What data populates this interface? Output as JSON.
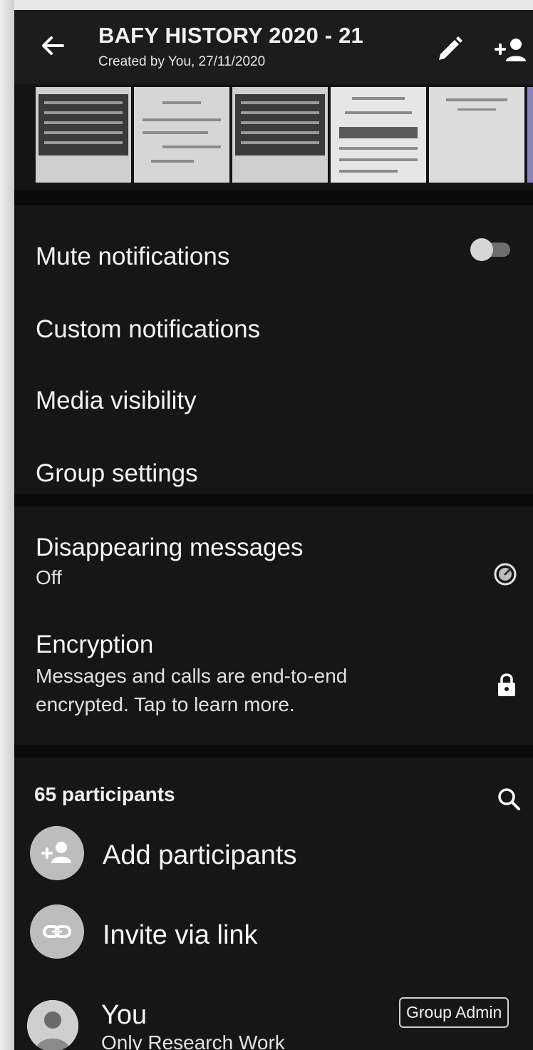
{
  "header": {
    "title": "BAFY HISTORY 2020 - 21",
    "subtitle": "Created by You, 27/11/2020",
    "icons": [
      "back-arrow-icon",
      "pencil-icon",
      "add-person-icon"
    ]
  },
  "settings": {
    "mute_notifications": {
      "label": "Mute notifications",
      "toggle_on": false
    },
    "custom_notifications": {
      "label": "Custom notifications"
    },
    "media_visibility": {
      "label": "Media visibility"
    },
    "group_settings": {
      "label": "Group settings"
    }
  },
  "disappearing": {
    "label": "Disappearing messages",
    "value": "Off",
    "icon": "timer-icon"
  },
  "encryption": {
    "label": "Encryption",
    "line1": "Messages and calls are end-to-end",
    "line2": "encrypted. Tap to learn more.",
    "icon": "lock-icon"
  },
  "participants": {
    "count_label": "65 participants",
    "add_label": "Add participants",
    "invite_label": "Invite via link",
    "members": [
      {
        "name": "You",
        "status": "Only Research Work",
        "badge": "Group Admin"
      }
    ]
  }
}
